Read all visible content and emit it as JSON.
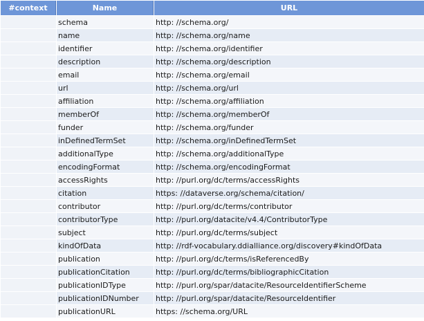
{
  "headers": {
    "context": "#context",
    "name": "Name",
    "url": "URL"
  },
  "rows": [
    {
      "context": "",
      "name": "schema",
      "url": "http: //schema.org/"
    },
    {
      "context": "",
      "name": "name",
      "url": "http: //schema.org/name"
    },
    {
      "context": "",
      "name": "identifier",
      "url": "http: //schema.org/identifier"
    },
    {
      "context": "",
      "name": "description",
      "url": "http: //schema.org/description"
    },
    {
      "context": "",
      "name": "email",
      "url": "http: //schema.org/email"
    },
    {
      "context": "",
      "name": "url",
      "url": "http: //schema.org/url"
    },
    {
      "context": "",
      "name": "affiliation",
      "url": "http: //schema.org/affiliation"
    },
    {
      "context": "",
      "name": "memberOf",
      "url": "http: //schema.org/memberOf"
    },
    {
      "context": "",
      "name": "funder",
      "url": "http: //schema.org/funder"
    },
    {
      "context": "",
      "name": "inDefinedTermSet",
      "url": "http: //schema.org/inDefinedTermSet"
    },
    {
      "context": "",
      "name": "additionalType",
      "url": "http: //schema.org/additionalType"
    },
    {
      "context": "",
      "name": "encodingFormat",
      "url": "http: //schema.org/encodingFormat"
    },
    {
      "context": "",
      "name": "accessRights",
      "url": "http: //purl.org/dc/terms/accessRights"
    },
    {
      "context": "",
      "name": "citation",
      "url": "https: //dataverse.org/schema/citation/"
    },
    {
      "context": "",
      "name": "contributor",
      "url": "http: //purl.org/dc/terms/contributor"
    },
    {
      "context": "",
      "name": "contributorType",
      "url": "http: //purl.org/datacite/v4.4/ContributorType"
    },
    {
      "context": "",
      "name": "subject",
      "url": "http: //purl.org/dc/terms/subject"
    },
    {
      "context": "",
      "name": "kindOfData",
      "url": "http: //rdf-vocabulary.ddialliance.org/discovery#kindOfData"
    },
    {
      "context": "",
      "name": "publication",
      "url": "http: //purl.org/dc/terms/isReferencedBy"
    },
    {
      "context": "",
      "name": "publicationCitation",
      "url": "http: //purl.org/dc/terms/bibliographicCitation"
    },
    {
      "context": "",
      "name": "publicationIDType",
      "url": "http: //purl.org/spar/datacite/ResourceIdentifierScheme"
    },
    {
      "context": "",
      "name": "publicationIDNumber",
      "url": "http: //purl.org/spar/datacite/ResourceIdentifier"
    },
    {
      "context": "",
      "name": "publicationURL",
      "url": "https: //schema.org/URL"
    }
  ]
}
